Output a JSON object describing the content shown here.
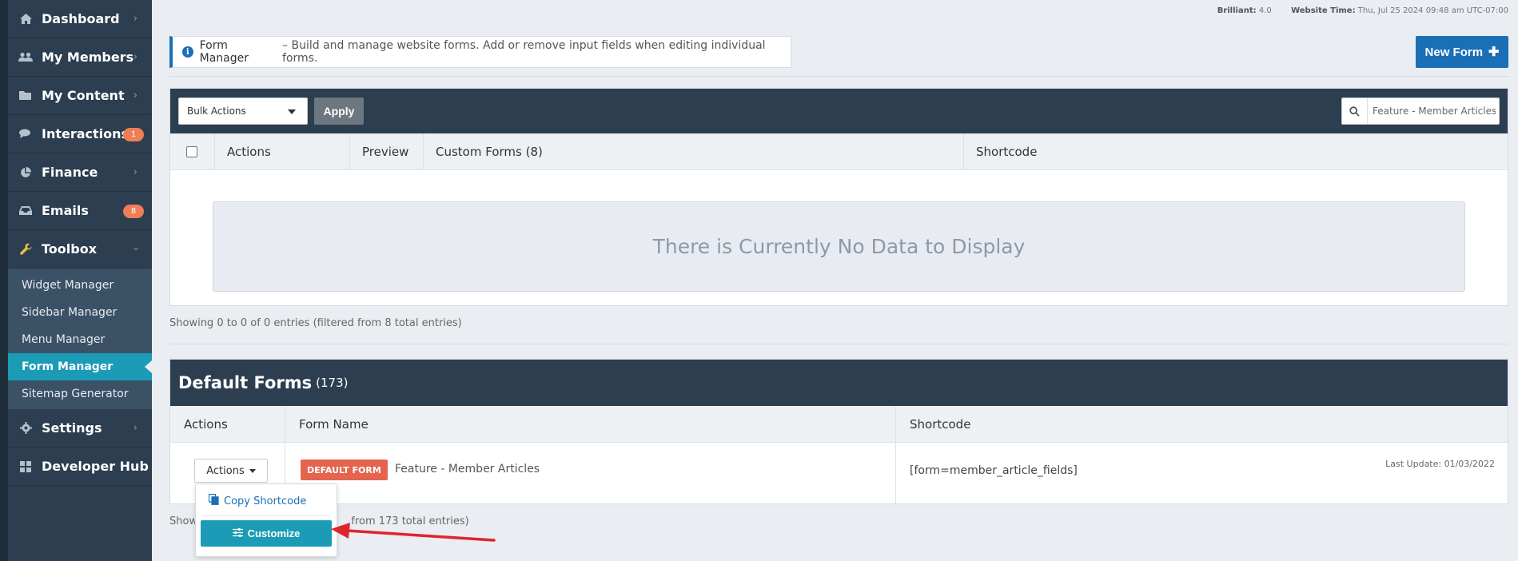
{
  "sidebar": {
    "items": [
      {
        "label": "Dashboard",
        "icon": "home-icon"
      },
      {
        "label": "My Members",
        "icon": "users-icon"
      },
      {
        "label": "My Content",
        "icon": "folder-icon"
      },
      {
        "label": "Interactions",
        "icon": "comments-icon",
        "badge": "1"
      },
      {
        "label": "Finance",
        "icon": "pie-chart-icon"
      },
      {
        "label": "Emails",
        "icon": "inbox-icon",
        "badge": "8"
      },
      {
        "label": "Toolbox",
        "icon": "wrench-icon"
      }
    ],
    "toolbox_sub": [
      "Widget Manager",
      "Sidebar Manager",
      "Menu Manager",
      "Form Manager",
      "Sitemap Generator"
    ],
    "active_sub": "Form Manager",
    "bottom_items": [
      {
        "label": "Settings",
        "icon": "gear-icon"
      },
      {
        "label": "Developer Hub",
        "icon": "grid-icon"
      }
    ]
  },
  "topinfo": {
    "brilliant_label": "Brilliant:",
    "brilliant_value": "4.0",
    "time_label": "Website Time:",
    "time_value": "Thu, Jul 25 2024 09:48 am UTC-07:00"
  },
  "notice": {
    "title": "Form Manager",
    "text": "– Build and manage website forms. Add or remove input fields when editing individual forms."
  },
  "new_form_label": "New Form",
  "custom": {
    "bulk_label": "Bulk Actions",
    "apply_label": "Apply",
    "search_value": "Feature - Member Articles",
    "columns": [
      "Actions",
      "Preview",
      "Custom Forms (8)",
      "Shortcode"
    ],
    "empty_text": "There is Currently No Data to Display",
    "showing": "Showing 0 to 0 of 0 entries (filtered from 8 total entries)"
  },
  "default": {
    "title": "Default Forms",
    "count": "(173)",
    "columns": [
      "Actions",
      "Form Name",
      "Shortcode"
    ],
    "row": {
      "actions_label": "Actions",
      "tag": "DEFAULT FORM",
      "name": "Feature - Member Articles",
      "shortcode": "[form=member_article_fields]",
      "last_update": "Last Update: 01/03/2022"
    },
    "showing_start": "Show",
    "showing_end": "from 173 total entries)"
  },
  "dropdown": {
    "copy_label": "Copy Shortcode",
    "customize_label": "Customize"
  },
  "colors": {
    "sidebar": "#2c3e50",
    "accent_blue": "#1b6fb6",
    "teal": "#1b9bb6",
    "badge": "#ef7e57",
    "tag_red": "#e3654f",
    "arrow_red": "#e0242c"
  }
}
